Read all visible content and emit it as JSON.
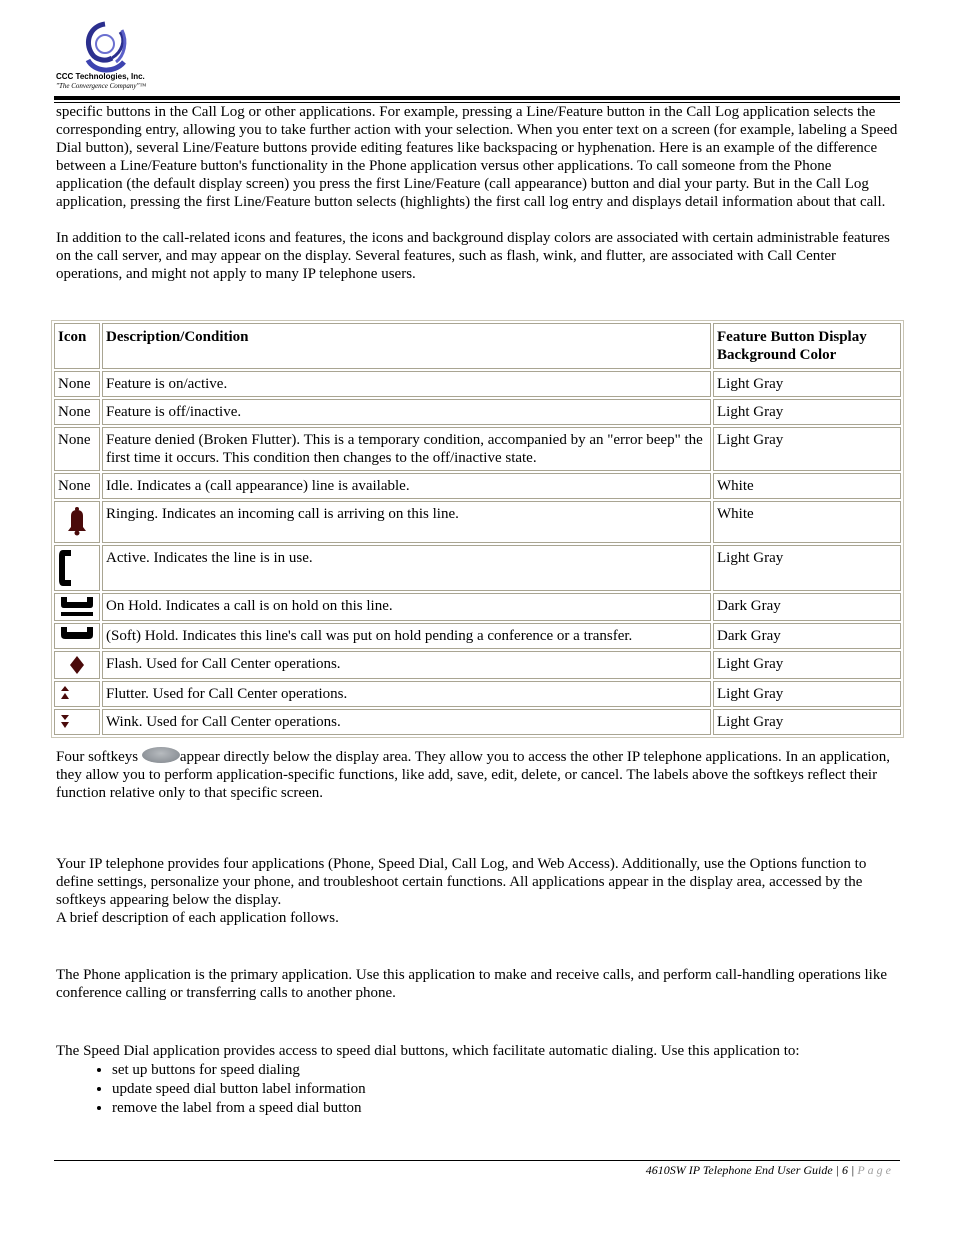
{
  "header": {
    "company_name": "CCC Technologies, Inc.",
    "tagline": "\"The Convergence Company\"™"
  },
  "intro": {
    "paragraph1": "specific buttons in the Call Log or other applications. For example, pressing a Line/Feature button in the Call Log application selects the corresponding entry, allowing you to take further action with your selection. When you enter text on a screen (for example, labeling a Speed Dial button), several Line/Feature buttons provide editing features like backspacing or hyphenation. Here is an example of the difference between a Line/Feature button's functionality in the Phone application versus other applications. To call someone from the Phone application (the default display screen) you press the first Line/Feature (call appearance) button and dial your party. But in the Call Log application, pressing the first Line/Feature button selects (highlights) the first call log entry and displays detail information about that call.",
    "paragraph2": "In addition to the call-related icons and features, the icons and background display colors are associated with certain administrable features on the call server, and may appear on the display. Several features, such as flash, wink, and flutter, are associated with Call Center operations, and might not apply to many IP telephone users."
  },
  "table": {
    "headers": {
      "icon": "Icon",
      "description": "Description/Condition",
      "color": "Feature Button Display Background Color"
    },
    "rows": [
      {
        "icon": "None",
        "icon_name": "",
        "description": "Feature is on/active.",
        "color": "Light Gray"
      },
      {
        "icon": "None",
        "icon_name": "",
        "description": "Feature is off/inactive.",
        "color": "Light Gray"
      },
      {
        "icon": "None",
        "icon_name": "",
        "description": "Feature denied (Broken Flutter). This is a temporary condition, accompanied by an \"error beep\" the first time it occurs. This condition then changes to the off/inactive state.",
        "color": "Light Gray"
      },
      {
        "icon": "None",
        "icon_name": "",
        "description": "Idle. Indicates a (call appearance) line is available.",
        "color": "White"
      },
      {
        "icon": "",
        "icon_name": "bell-icon",
        "description": "Ringing. Indicates an incoming call is arriving on this line.",
        "color": "White"
      },
      {
        "icon": "",
        "icon_name": "handset-active-icon",
        "description": "Active. Indicates the line is in use.",
        "color": "Light Gray"
      },
      {
        "icon": "",
        "icon_name": "handset-hold-icon",
        "description": "On Hold. Indicates a call is on hold on this line.",
        "color": "Dark Gray"
      },
      {
        "icon": "",
        "icon_name": "handset-soft-hold-icon",
        "description": "(Soft) Hold. Indicates this line's call was put on hold pending a conference or a transfer.",
        "color": "Dark Gray"
      },
      {
        "icon": "",
        "icon_name": "diamond-flash-icon",
        "description": "Flash. Used for Call Center operations.",
        "color": "Light Gray"
      },
      {
        "icon": "",
        "icon_name": "flutter-arrows-icon",
        "description": "Flutter. Used for Call Center operations.",
        "color": "Light Gray"
      },
      {
        "icon": "",
        "icon_name": "wink-arrows-icon",
        "description": "Wink. Used for Call Center operations.",
        "color": "Light Gray"
      }
    ]
  },
  "softkeys": {
    "before": "Four softkeys ",
    "after": "appear directly below the display area. They allow you to access the other IP telephone applications. In an application, they allow you to perform application-specific functions, like add, save, edit, delete, or cancel. The labels above the softkeys reflect their function relative only to that specific screen."
  },
  "applications": {
    "paragraph": "Your IP telephone provides four applications (Phone, Speed Dial, Call Log, and Web Access). Additionally, use the Options function to define settings, personalize your phone, and troubleshoot certain functions. All applications appear in the display area, accessed by the softkeys appearing below the display.",
    "brief": "A brief description of each application follows."
  },
  "phone_app": {
    "paragraph": "The Phone application is the primary application. Use this application to make and receive calls, and perform call-handling operations like conference calling or transferring calls to another phone."
  },
  "speed_dial": {
    "paragraph": "The Speed Dial application provides access to speed dial buttons, which facilitate automatic dialing. Use this application to:",
    "bullets": [
      "set up buttons for speed dialing",
      "update speed dial button label information",
      "remove the label from a speed dial button"
    ]
  },
  "footer": {
    "guide_title": "4610SW IP Telephone End User Guide",
    "separator": "|",
    "page_number": "6",
    "page_word": "Page"
  },
  "colors": {
    "icon_dark_red": "#4a0a0a",
    "table_border": "#a9a592"
  }
}
